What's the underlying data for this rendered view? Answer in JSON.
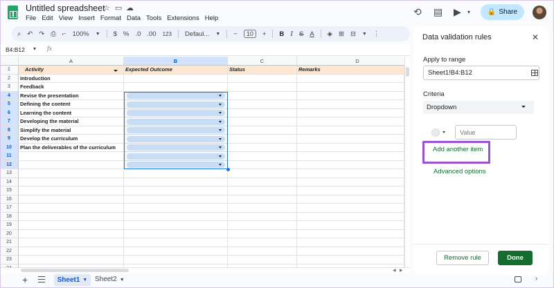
{
  "app": {
    "title": "Untitled spreadsheet"
  },
  "menu": [
    "File",
    "Edit",
    "View",
    "Insert",
    "Format",
    "Data",
    "Tools",
    "Extensions",
    "Help"
  ],
  "header": {
    "share_label": "Share"
  },
  "toolbar": {
    "zoom": "100%",
    "currency": "$",
    "percent": "%",
    "decimal_dec": ".0",
    "decimal_inc": ".00",
    "format": "123",
    "font": "Defaul...",
    "font_size": "10",
    "bold": "B",
    "italic": "I",
    "strike": "S",
    "text_color": "A"
  },
  "formula_bar": {
    "name_box": "B4:B12",
    "fx": "fx"
  },
  "grid": {
    "columns": [
      "A",
      "B",
      "C",
      "D"
    ],
    "rows": [
      "1",
      "2",
      "3",
      "4",
      "5",
      "6",
      "7",
      "8",
      "9",
      "10",
      "11",
      "12",
      "13",
      "14",
      "15",
      "16",
      "17",
      "18",
      "19",
      "20",
      "21",
      "22",
      "23",
      "24"
    ],
    "header_row": {
      "a": "Activity",
      "b": "Expected Outcome",
      "c": "Status",
      "d": "Remarks"
    },
    "col_a": [
      "",
      "Introduction",
      "Feedback",
      "Revise the presentation",
      "Defining the content",
      "Learning the content",
      "Developing the material",
      "Simplify the material",
      "Develop the curriculum",
      "Plan the deliverables of the curriculum"
    ]
  },
  "tabs": {
    "sheet1": "Sheet1",
    "sheet2": "Sheet2"
  },
  "panel": {
    "title": "Data validation rules",
    "apply_label": "Apply to range",
    "range": "Sheet1!B4:B12",
    "criteria_label": "Criteria",
    "criteria_value": "Dropdown",
    "value_placeholder": "Value",
    "add_item": "Add another item",
    "advanced": "Advanced options",
    "remove": "Remove rule",
    "done": "Done"
  }
}
